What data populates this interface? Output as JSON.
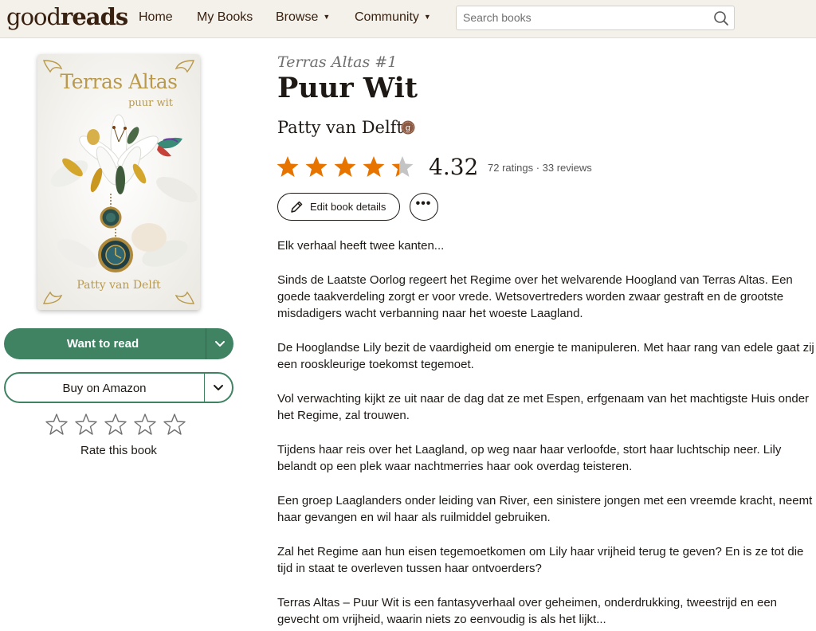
{
  "header": {
    "logo": {
      "good": "good",
      "reads": "reads"
    },
    "nav": [
      {
        "label": "Home"
      },
      {
        "label": "My Books"
      },
      {
        "label": "Browse"
      },
      {
        "label": "Community"
      }
    ],
    "search_placeholder": "Search books"
  },
  "cover": {
    "title": "Terras Altas",
    "subtitle": "puur wit",
    "author": "Patty van Delft"
  },
  "actions": {
    "want_to_read": "Want to read",
    "buy": "Buy on Amazon",
    "rate_label": "Rate this book"
  },
  "book": {
    "series": "Terras Altas #1",
    "title": "Puur Wit",
    "author": "Patty van Delft",
    "rating": 4.32,
    "rating_display": "4.32",
    "ratings_text": "72 ratings · 33 reviews",
    "edit_label": "Edit book details",
    "more_label": "•••"
  },
  "colors": {
    "header_bg": "#f4f1ea",
    "primary_green": "#3f8363",
    "star_orange": "#e87400",
    "star_empty": "#c4c4c4"
  },
  "description": [
    "Elk verhaal heeft twee kanten...",
    "Sinds de Laatste Oorlog regeert het Regime over het welvarende Hoogland van Terras Altas. Een goede taakverdeling zorgt er voor vrede. Wetsovertreders worden zwaar gestraft en de grootste misdadigers wacht verbanning naar het woeste Laagland.",
    "De Hooglandse Lily bezit de vaardigheid om energie te manipuleren. Met haar rang van edele gaat zij een rooskleurige toekomst tegemoet.",
    "Vol verwachting kijkt ze uit naar de dag dat ze met Espen, erfgenaam van het machtigste Huis onder het Regime, zal trouwen.",
    "Tijdens haar reis over het Laagland, op weg naar haar verloofde, stort haar luchtschip neer. Lily belandt op een plek waar nachtmerries haar ook overdag teisteren.",
    "Een groep Laaglanders onder leiding van River, een sinistere jongen met een vreemde kracht, neemt haar gevangen en wil haar als ruilmiddel gebruiken.",
    "Zal het Regime aan hun eisen tegemoetkomen om Lily haar vrijheid terug te geven? En is ze tot die tijd in staat te overleven tussen haar ontvoerders?",
    "Terras Altas – Puur Wit is een fantasyverhaal over geheimen, onderdrukking, tweestrijd en een gevecht om vrijheid, waarin niets zo eenvoudig is als het lijkt..."
  ]
}
